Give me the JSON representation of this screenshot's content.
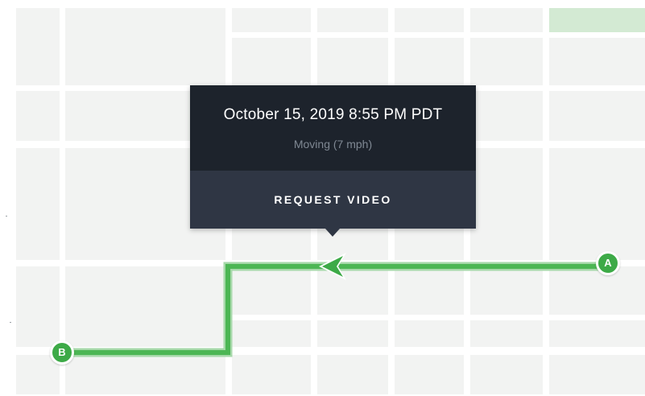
{
  "map": {
    "background_color": "#f2f3f2",
    "road_color": "#ffffff",
    "park_color": "#d3ead3",
    "route_color": "#4cb654",
    "direction_icon": "arrow-left-icon"
  },
  "popover": {
    "datetime": "October 15, 2019 8:55 PM PDT",
    "status": "Moving (7 mph)",
    "action_label": "REQUEST VIDEO"
  },
  "markers": {
    "start_label": "A",
    "end_label": "B"
  }
}
